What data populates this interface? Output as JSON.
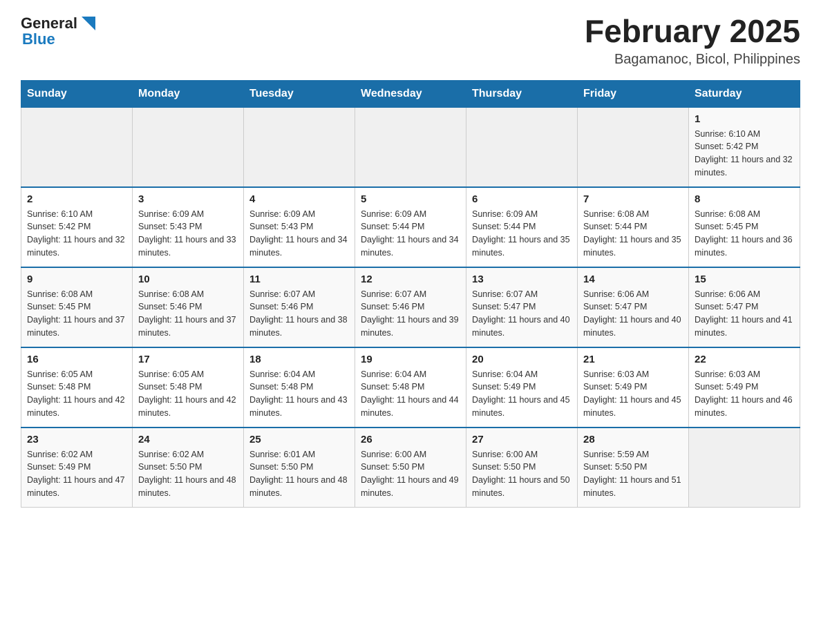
{
  "header": {
    "logo": {
      "text_general": "General",
      "text_blue": "Blue",
      "aria": "GeneralBlue logo"
    },
    "title": "February 2025",
    "subtitle": "Bagamanoc, Bicol, Philippines"
  },
  "calendar": {
    "days_of_week": [
      "Sunday",
      "Monday",
      "Tuesday",
      "Wednesday",
      "Thursday",
      "Friday",
      "Saturday"
    ],
    "weeks": [
      [
        {
          "day": "",
          "info": ""
        },
        {
          "day": "",
          "info": ""
        },
        {
          "day": "",
          "info": ""
        },
        {
          "day": "",
          "info": ""
        },
        {
          "day": "",
          "info": ""
        },
        {
          "day": "",
          "info": ""
        },
        {
          "day": "1",
          "info": "Sunrise: 6:10 AM\nSunset: 5:42 PM\nDaylight: 11 hours and 32 minutes."
        }
      ],
      [
        {
          "day": "2",
          "info": "Sunrise: 6:10 AM\nSunset: 5:42 PM\nDaylight: 11 hours and 32 minutes."
        },
        {
          "day": "3",
          "info": "Sunrise: 6:09 AM\nSunset: 5:43 PM\nDaylight: 11 hours and 33 minutes."
        },
        {
          "day": "4",
          "info": "Sunrise: 6:09 AM\nSunset: 5:43 PM\nDaylight: 11 hours and 34 minutes."
        },
        {
          "day": "5",
          "info": "Sunrise: 6:09 AM\nSunset: 5:44 PM\nDaylight: 11 hours and 34 minutes."
        },
        {
          "day": "6",
          "info": "Sunrise: 6:09 AM\nSunset: 5:44 PM\nDaylight: 11 hours and 35 minutes."
        },
        {
          "day": "7",
          "info": "Sunrise: 6:08 AM\nSunset: 5:44 PM\nDaylight: 11 hours and 35 minutes."
        },
        {
          "day": "8",
          "info": "Sunrise: 6:08 AM\nSunset: 5:45 PM\nDaylight: 11 hours and 36 minutes."
        }
      ],
      [
        {
          "day": "9",
          "info": "Sunrise: 6:08 AM\nSunset: 5:45 PM\nDaylight: 11 hours and 37 minutes."
        },
        {
          "day": "10",
          "info": "Sunrise: 6:08 AM\nSunset: 5:46 PM\nDaylight: 11 hours and 37 minutes."
        },
        {
          "day": "11",
          "info": "Sunrise: 6:07 AM\nSunset: 5:46 PM\nDaylight: 11 hours and 38 minutes."
        },
        {
          "day": "12",
          "info": "Sunrise: 6:07 AM\nSunset: 5:46 PM\nDaylight: 11 hours and 39 minutes."
        },
        {
          "day": "13",
          "info": "Sunrise: 6:07 AM\nSunset: 5:47 PM\nDaylight: 11 hours and 40 minutes."
        },
        {
          "day": "14",
          "info": "Sunrise: 6:06 AM\nSunset: 5:47 PM\nDaylight: 11 hours and 40 minutes."
        },
        {
          "day": "15",
          "info": "Sunrise: 6:06 AM\nSunset: 5:47 PM\nDaylight: 11 hours and 41 minutes."
        }
      ],
      [
        {
          "day": "16",
          "info": "Sunrise: 6:05 AM\nSunset: 5:48 PM\nDaylight: 11 hours and 42 minutes."
        },
        {
          "day": "17",
          "info": "Sunrise: 6:05 AM\nSunset: 5:48 PM\nDaylight: 11 hours and 42 minutes."
        },
        {
          "day": "18",
          "info": "Sunrise: 6:04 AM\nSunset: 5:48 PM\nDaylight: 11 hours and 43 minutes."
        },
        {
          "day": "19",
          "info": "Sunrise: 6:04 AM\nSunset: 5:48 PM\nDaylight: 11 hours and 44 minutes."
        },
        {
          "day": "20",
          "info": "Sunrise: 6:04 AM\nSunset: 5:49 PM\nDaylight: 11 hours and 45 minutes."
        },
        {
          "day": "21",
          "info": "Sunrise: 6:03 AM\nSunset: 5:49 PM\nDaylight: 11 hours and 45 minutes."
        },
        {
          "day": "22",
          "info": "Sunrise: 6:03 AM\nSunset: 5:49 PM\nDaylight: 11 hours and 46 minutes."
        }
      ],
      [
        {
          "day": "23",
          "info": "Sunrise: 6:02 AM\nSunset: 5:49 PM\nDaylight: 11 hours and 47 minutes."
        },
        {
          "day": "24",
          "info": "Sunrise: 6:02 AM\nSunset: 5:50 PM\nDaylight: 11 hours and 48 minutes."
        },
        {
          "day": "25",
          "info": "Sunrise: 6:01 AM\nSunset: 5:50 PM\nDaylight: 11 hours and 48 minutes."
        },
        {
          "day": "26",
          "info": "Sunrise: 6:00 AM\nSunset: 5:50 PM\nDaylight: 11 hours and 49 minutes."
        },
        {
          "day": "27",
          "info": "Sunrise: 6:00 AM\nSunset: 5:50 PM\nDaylight: 11 hours and 50 minutes."
        },
        {
          "day": "28",
          "info": "Sunrise: 5:59 AM\nSunset: 5:50 PM\nDaylight: 11 hours and 51 minutes."
        },
        {
          "day": "",
          "info": ""
        }
      ]
    ]
  }
}
